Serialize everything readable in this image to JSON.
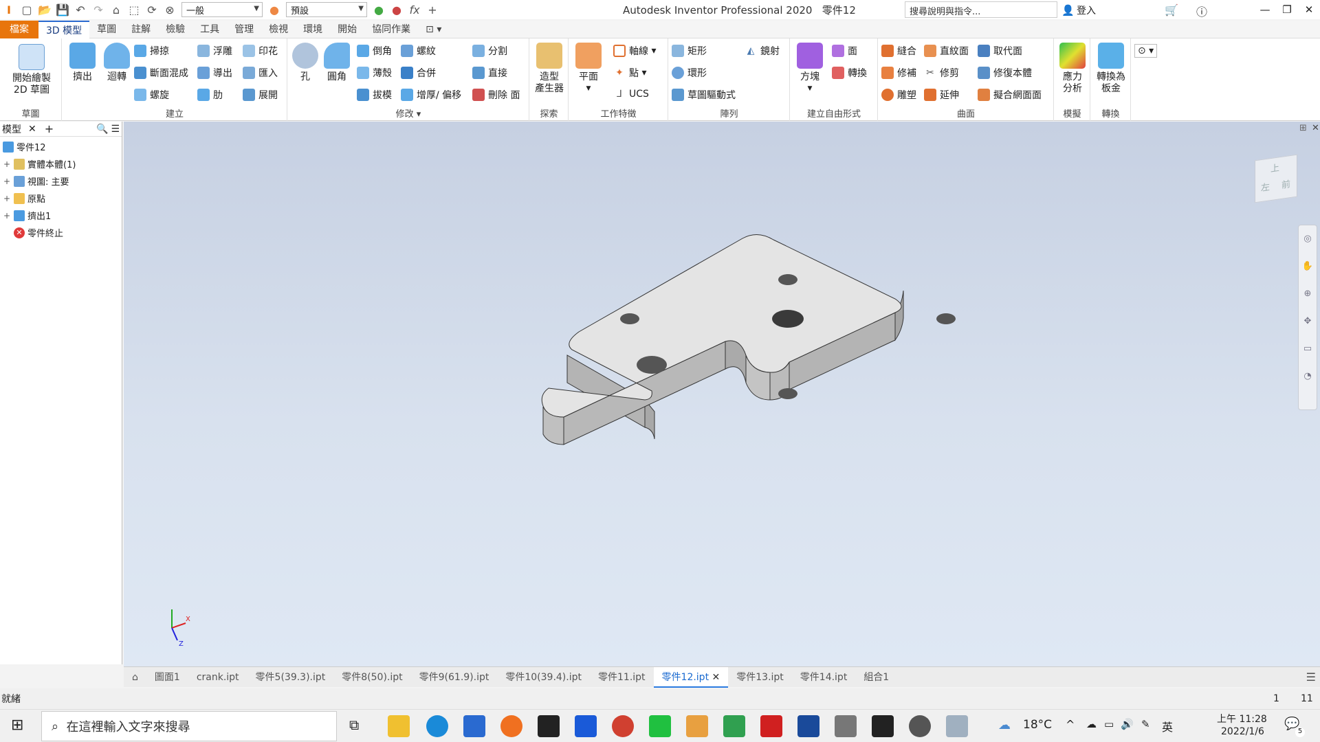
{
  "titlebar": {
    "style_combo": "一般",
    "appearance_combo": "預設",
    "title": "Autodesk Inventor Professional 2020",
    "document": "零件12",
    "help_search": "搜尋說明與指令...",
    "signin": "登入"
  },
  "tabs": [
    "檔案",
    "3D 模型",
    "草圖",
    "註解",
    "檢驗",
    "工具",
    "管理",
    "檢視",
    "環境",
    "開始",
    "協同作業"
  ],
  "ribbon": {
    "sketch": {
      "title": "草圖",
      "start_sketch": "開始繪製\n2D 草圖"
    },
    "create": {
      "title": "建立",
      "extrude": "擠出",
      "revolve": "迴轉",
      "sweep": "掃掠",
      "loft": "斷面混成",
      "coil": "螺旋",
      "emboss": "浮雕",
      "derive": "導出",
      "rib": "肋",
      "decal": "印花",
      "import": "匯入",
      "unwrap": "展開"
    },
    "modify": {
      "title": "修改",
      "hole": "孔",
      "fillet": "圓角",
      "chamfer": "倒角",
      "shell": "薄殼",
      "draft": "拔模",
      "thread": "螺紋",
      "combine": "合併",
      "thicken": "增厚/ 偏移",
      "split": "分割",
      "direct": "直接",
      "delete_face": "刪除 面"
    },
    "explore": {
      "title": "探索",
      "shape_generator": "造型\n產生器"
    },
    "work": {
      "title": "工作特徵",
      "plane": "平面",
      "axis": "軸線",
      "point": "點",
      "ucs": "UCS"
    },
    "pattern": {
      "title": "陣列",
      "rect": "矩形",
      "circ": "環形",
      "sketch_driven": "草圖驅動式",
      "mirror": "鏡射"
    },
    "freeform": {
      "title": "建立自由形式",
      "box": "方塊",
      "face": "面",
      "convert": "轉換"
    },
    "surface": {
      "title": "曲面",
      "stitch": "縫合",
      "patch": "修補",
      "sculpt": "雕塑",
      "ruled": "直紋面",
      "trim": "修剪",
      "extend": "延伸",
      "replace": "取代面",
      "repair": "修復本體",
      "fit_mesh": "擬合網面面"
    },
    "simulation": {
      "title": "模擬",
      "stress": "應力\n分析"
    },
    "convert": {
      "title": "轉換",
      "sheet_metal": "轉換為\n板金"
    }
  },
  "browser": {
    "tab": "模型",
    "root": "零件12",
    "nodes": [
      "實體本體(1)",
      "視圖: 主要",
      "原點",
      "擠出1",
      "零件終止"
    ]
  },
  "viewcube": {
    "top": "上",
    "front": "前",
    "left": "左"
  },
  "triad": {
    "x": "X",
    "z": "Z"
  },
  "doc_tabs": [
    "圖面1",
    "crank.ipt",
    "零件5(39.3).ipt",
    "零件8(50).ipt",
    "零件9(61.9).ipt",
    "零件10(39.4).ipt",
    "零件11.ipt",
    "零件12.ipt",
    "零件13.ipt",
    "零件14.ipt",
    "組合1"
  ],
  "status": {
    "text": "就緒",
    "v1": "1",
    "v2": "11"
  },
  "taskbar": {
    "search": "在這裡輸入文字來搜尋",
    "temp": "18°C",
    "ime": "英",
    "time": "上午 11:28",
    "date": "2022/1/6",
    "notif": "5"
  }
}
